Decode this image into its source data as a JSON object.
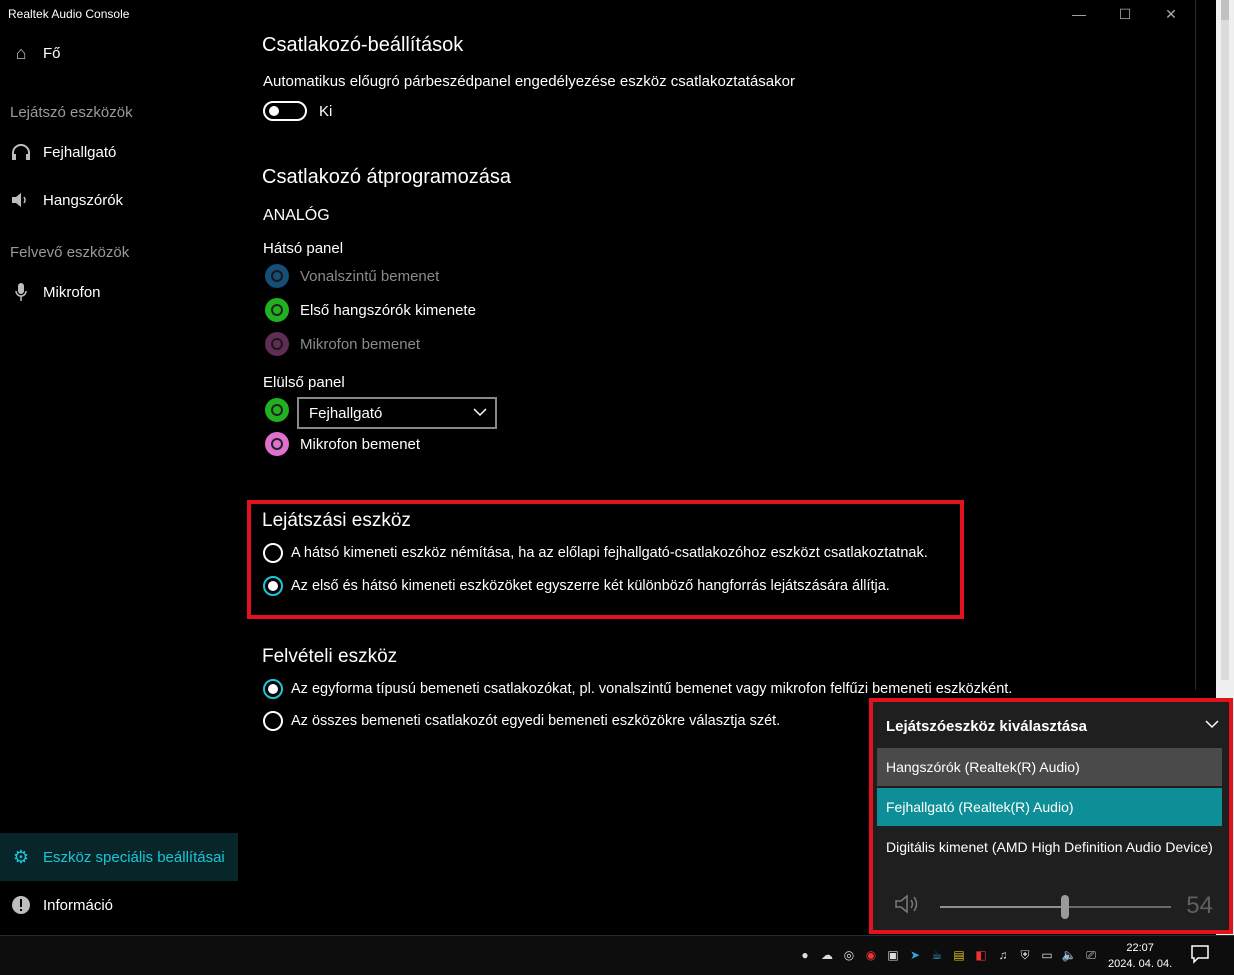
{
  "window": {
    "title": "Realtek Audio Console"
  },
  "sidebar": {
    "home": "Fő",
    "playback_section": "Lejátszó eszközök",
    "headphones": "Fejhallgató",
    "speakers": "Hangszórók",
    "record_section": "Felvevő eszközök",
    "microphone": "Mikrofon",
    "advanced": "Eszköz speciális beállításai",
    "info": "Információ"
  },
  "connector_settings": {
    "title": "Csatlakozó-beállítások",
    "auto_popup_label": "Automatikus előugró párbeszédpanel engedélyezése eszköz csatlakoztatásakor",
    "toggle_state": "Ki"
  },
  "retasking": {
    "title": "Csatlakozó átprogramozása",
    "analog": "ANALÓG",
    "rear_panel": "Hátsó panel",
    "rear_jacks": [
      {
        "label": "Vonalszintű bemenet",
        "color": "#1e6fa8"
      },
      {
        "label": "Első hangszórók kimenete",
        "color": "#20b020"
      },
      {
        "label": "Mikrofon bemenet",
        "color": "#8a3f7a"
      }
    ],
    "front_panel": "Elülső panel",
    "front_jack_select": "Fejhallgató",
    "front_jack_mic": "Mikrofon bemenet",
    "front_green": "#20b020",
    "front_pink": "#e070d0"
  },
  "playback_device": {
    "title": "Lejátszási eszköz",
    "option1": "A hátsó kimeneti eszköz némítása, ha az előlapi fejhallgató-csatlakozóhoz eszközt csatlakoztatnak.",
    "option2": "Az első és hátsó kimeneti eszközöket egyszerre két különböző hangforrás lejátszására állítja.",
    "selected": 2
  },
  "recording_device": {
    "title": "Felvételi eszköz",
    "option1": "Az egyforma típusú bemeneti csatlakozókat, pl. vonalszintű bemenet vagy mikrofon felfűzi bemeneti eszközként.",
    "option2": "Az összes bemeneti csatlakozót egyedi bemeneti eszközökre választja szét.",
    "selected": 1
  },
  "flyout": {
    "title": "Lejátszóeszköz kiválasztása",
    "items": [
      "Hangszórók (Realtek(R) Audio)",
      "Fejhallgató (Realtek(R) Audio)",
      "Digitális kimenet (AMD High Definition Audio Device)"
    ],
    "selected": 1,
    "volume": 54,
    "volume_text": "54"
  },
  "taskbar": {
    "time": "22:07",
    "date": "2024. 04. 04."
  },
  "colors": {
    "accent": "#18c6d8",
    "highlight_red": "#e3131e",
    "flyout_selected": "#0e8f97"
  }
}
